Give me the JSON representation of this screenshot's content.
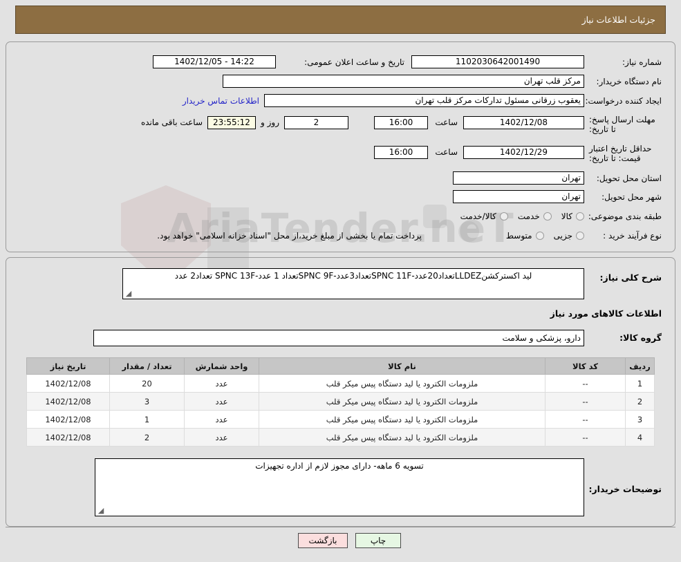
{
  "header": {
    "title": "جزئیات اطلاعات نیاز"
  },
  "watermark": {
    "text": "AriaTender.neT"
  },
  "form": {
    "need_number_label": "شماره نیاز:",
    "need_number_value": "1102030642001490",
    "public_announce_label": "تاریخ و ساعت اعلان عمومی:",
    "public_announce_value": "14:22 - 1402/12/05",
    "buyer_org_label": "نام دستگاه خریدار:",
    "buyer_org_value": "مرکز قلب تهران",
    "creator_label": "ایجاد کننده درخواست:",
    "creator_value": "یعقوب زرقانی مسئول تدارکات مرکز قلب تهران",
    "contact_link": "اطلاعات تماس خریدار",
    "reply_deadline_label": "مهلت ارسال پاسخ: تا تاریخ:",
    "reply_deadline_date": "1402/12/08",
    "reply_deadline_hour_label": "ساعت",
    "reply_deadline_hour": "16:00",
    "remaining_days": "2",
    "remaining_days_label": "روز و",
    "remaining_time": "23:55:12",
    "remaining_time_label": "ساعت باقی مانده",
    "price_validity_label": "حداقل تاریخ اعتبار قیمت: تا تاریخ:",
    "price_validity_date": "1402/12/29",
    "price_validity_hour_label": "ساعت",
    "price_validity_hour": "16:00",
    "province_label": "استان محل تحویل:",
    "province_value": "تهران",
    "city_label": "شهر محل تحویل:",
    "city_value": "تهران",
    "category_label": "طبقه بندی موضوعی:",
    "category_options": [
      "کالا",
      "خدمت",
      "کالا/خدمت"
    ],
    "category_selected": "",
    "process_label": "نوع فرآیند خرید :",
    "process_options": [
      "جزیی",
      "متوسط"
    ],
    "process_selected": "",
    "process_note": "پرداخت تمام یا بخشی از مبلغ خرید،از محل \"اسناد خزانه اسلامی\" خواهد بود."
  },
  "summary": {
    "label": "شرح کلی نیاز:",
    "value": "لید اکسترکشنLLDEZتعداد20عدد-SPNC 11Fتعداد3عدد-SPNC 9Fتعداد 1 عدد-SPNC 13F تعداد2 عدد"
  },
  "goods_section": {
    "heading": "اطلاعات کالاهای مورد نیاز",
    "group_label": "گروه کالا:",
    "group_value": "دارو، پزشکی و سلامت"
  },
  "table": {
    "columns": [
      "ردیف",
      "کد کالا",
      "نام کالا",
      "واحد شمارش",
      "تعداد / مقدار",
      "تاریخ نیاز"
    ],
    "rows": [
      {
        "row": "1",
        "code": "--",
        "name": "ملزومات الکترود یا لید دستگاه پیس میکر قلب",
        "unit": "عدد",
        "qty": "20",
        "date": "1402/12/08"
      },
      {
        "row": "2",
        "code": "--",
        "name": "ملزومات الکترود یا لید دستگاه پیس میکر قلب",
        "unit": "عدد",
        "qty": "3",
        "date": "1402/12/08"
      },
      {
        "row": "3",
        "code": "--",
        "name": "ملزومات الکترود یا لید دستگاه پیس میکر قلب",
        "unit": "عدد",
        "qty": "1",
        "date": "1402/12/08"
      },
      {
        "row": "4",
        "code": "--",
        "name": "ملزومات الکترود یا لید دستگاه پیس میکر قلب",
        "unit": "عدد",
        "qty": "2",
        "date": "1402/12/08"
      }
    ]
  },
  "buyer_notes": {
    "label": "توضیحات خریدار:",
    "value": "تسویه 6 ماهه- دارای مجوز لازم از اداره تجهیزات"
  },
  "buttons": {
    "print": "چاپ",
    "back": "بازگشت"
  },
  "colors": {
    "header_bg": "#8d6e42",
    "link": "#2323c8",
    "print_bg": "#e6f7e3",
    "back_bg": "#fbdede",
    "highlight": "#fbfbe4"
  }
}
